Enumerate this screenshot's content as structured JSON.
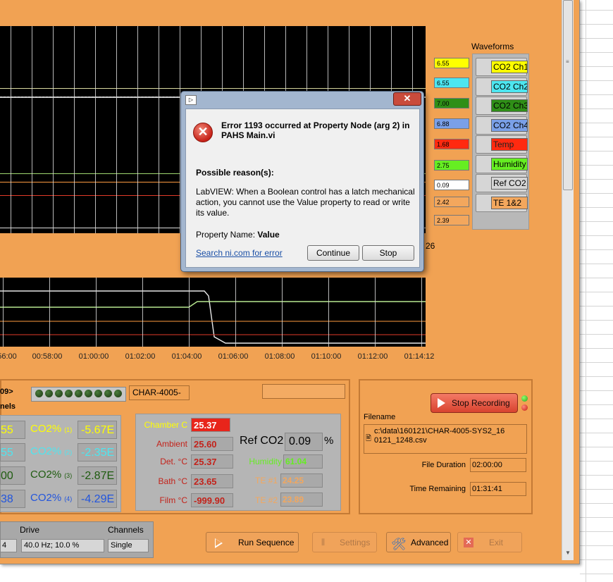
{
  "colors": {
    "panel_bg": "#f1a253",
    "plot_bg": "#000000",
    "stop_button": "#e8533f",
    "error_red": "#c62218",
    "link_blue": "#1a4fa6"
  },
  "waveforms": {
    "title": "Waveforms",
    "values": [
      "6.55",
      "6.55",
      "7.00",
      "6.88",
      "1.68",
      "2.75",
      "0.09",
      "2.42",
      "2.39"
    ],
    "value_colors": [
      "#ffff00",
      "#4de6f0",
      "#2f8f17",
      "#7aa0e8",
      "#ff2a10",
      "#66ee22",
      "#ffffff",
      "#f3a75d",
      "#f3a75d"
    ],
    "buttons": [
      {
        "label": "CO2 Ch1",
        "color": "#ffff00"
      },
      {
        "label": "CO2 Ch2",
        "color": "#4de6f0"
      },
      {
        "label": "CO2 Ch3",
        "color": "#2f8f17"
      },
      {
        "label": "CO2 Ch4",
        "color": "#7aa0e8"
      },
      {
        "label": "Temp",
        "color": "#ff2a10"
      },
      {
        "label": "Humidity",
        "color": "#66ee22"
      },
      {
        "label": "Ref CO2",
        "color": "#d6d6d6"
      },
      {
        "label": "TE 1&2",
        "color": "#f3a75d"
      }
    ],
    "extra_value": "26"
  },
  "chart": {
    "x_ticks": [
      "56:00",
      "00:58:00",
      "01:00:00",
      "01:02:00",
      "01:04:00",
      "01:06:00",
      "01:08:00",
      "01:10:00",
      "01:12:00",
      "01:14:12"
    ]
  },
  "dialog": {
    "title_text": "Error 1193 occurred at Property Node (arg 2) in PAHS Main.vi",
    "reason_label": "Possible reason(s):",
    "description": "LabVIEW:  When a Boolean control has a latch mechanical action, you cannot use the Value property to read or write its value.",
    "property_label": "Property Name: ",
    "property_value": "Value",
    "link": "Search ni.com for error",
    "continue_label": "Continue",
    "stop_label": "Stop",
    "close_label": "✕"
  },
  "status": {
    "partial_label": "09>",
    "channels_header": "nels",
    "device_name": "CHAR-4005-",
    "empty_field": ""
  },
  "co2": {
    "left_values": [
      "55",
      "55",
      "00",
      "38"
    ],
    "left_colors": [
      "#ffff00",
      "#4de6f0",
      "#1e5b0f",
      "#2255dd"
    ],
    "labels": [
      "CO2%",
      "CO2%",
      "CO2%",
      "CO2%"
    ],
    "subs": [
      "(1)",
      "(2)",
      "(3)",
      "(4)"
    ],
    "label_colors": [
      "#ffff00",
      "#4de6f0",
      "#1e5b0f",
      "#2255dd"
    ],
    "values": [
      "-5.67E",
      "-2.35E",
      "-2.87E",
      "-4.29E"
    ],
    "value_colors": [
      "#ffff00",
      "#4de6f0",
      "#1e5b0f",
      "#2255dd"
    ]
  },
  "chamber": {
    "rows": [
      {
        "label": "Chamber C",
        "value": "25.37",
        "label_color": "#ffff00"
      },
      {
        "label": "Ambient",
        "value": "25.60",
        "label_color": "#c3231b"
      },
      {
        "label": "Det. °C",
        "value": "25.37",
        "label_color": "#c3231b"
      },
      {
        "label": "Bath °C",
        "value": "23.65",
        "label_color": "#c3231b"
      },
      {
        "label": "Film °C",
        "value": "-999.90",
        "label_color": "#c3231b"
      }
    ],
    "ref_label": "Ref CO2",
    "ref_value": "0.09",
    "ref_unit": "%",
    "humidity_label": "Humidity",
    "humidity_value": "61.04",
    "te1_label": "TE #1",
    "te1_value": "24.25",
    "te2_label": "TE #2",
    "te2_value": "23.89"
  },
  "recording": {
    "stop_label": "Stop Recording",
    "filename_label": "Filename",
    "filename_value": "c:\\data\\160121\\CHAR-4005-SYS2_160121_1248.csv",
    "duration_label": "File Duration",
    "duration_value": "02:00:00",
    "remaining_label": "Time Remaining",
    "remaining_value": "01:31:41"
  },
  "bottom": {
    "drive_label": "Drive",
    "channels_label": "Channels",
    "left_value": "4",
    "drive_value": "40.0 Hz; 10.0 %",
    "channels_value": "Single",
    "run_label": "Run Sequence",
    "settings_label": "Settings",
    "advanced_label": "Advanced",
    "exit_label": "Exit"
  }
}
